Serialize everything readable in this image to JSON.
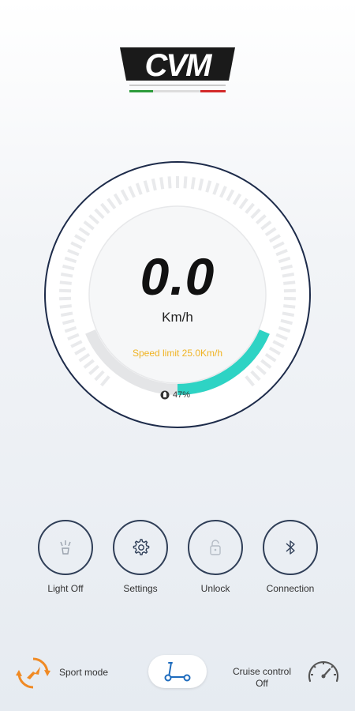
{
  "header": {
    "logo_name": "cvm-logo",
    "logo_text": "CVM"
  },
  "speedometer": {
    "speed": "0.0",
    "unit": "Km/h",
    "speed_limit": "Speed limit  25.0Km/h",
    "battery_text": "47%",
    "battery_level": 0.47,
    "colors": {
      "accent": "#2ed3c4",
      "ring": "#1d2b4a",
      "limit_text": "#f0b323"
    }
  },
  "controls": [
    {
      "name": "light",
      "label": "Light Off",
      "icon": "headlight-icon"
    },
    {
      "name": "settings",
      "label": "Settings",
      "icon": "gear-icon"
    },
    {
      "name": "unlock",
      "label": "Unlock",
      "icon": "padlock-icon"
    },
    {
      "name": "connection",
      "label": "Connection",
      "icon": "bluetooth-icon"
    }
  ],
  "bottom_bar": {
    "sport_mode_label": "Sport mode",
    "cruise_control_label": "Cruise control",
    "cruise_control_state": "Off",
    "colors": {
      "sport_icon": "#f08a24",
      "scooter_icon": "#1d6bbd"
    }
  }
}
